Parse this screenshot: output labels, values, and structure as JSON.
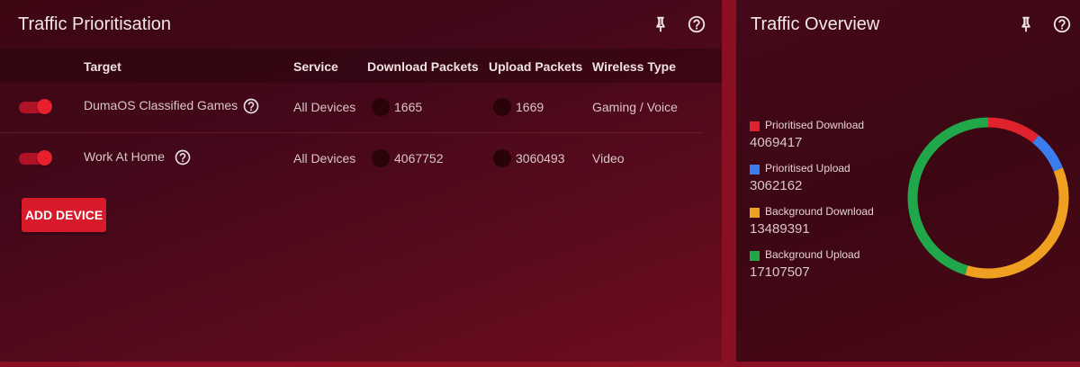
{
  "prioritisation": {
    "title": "Traffic Prioritisation",
    "columns": {
      "target": "Target",
      "service": "Service",
      "download": "Download Packets",
      "upload": "Upload Packets",
      "wireless": "Wireless Type"
    },
    "rows": [
      {
        "enabled": true,
        "target": "DumaOS Classified Games",
        "service": "All Devices",
        "download": "1665",
        "upload": "1669",
        "wireless": "Gaming / Voice"
      },
      {
        "enabled": true,
        "target": "Work At Home",
        "service": "All Devices",
        "download": "4067752",
        "upload": "3060493",
        "wireless": "Video"
      }
    ],
    "add_button": "ADD DEVICE"
  },
  "overview": {
    "title": "Traffic Overview",
    "legend": [
      {
        "label": "Prioritised Download",
        "value": "4069417",
        "color": "#e0222c"
      },
      {
        "label": "Prioritised Upload",
        "value": "3062162",
        "color": "#3b7df0"
      },
      {
        "label": "Background Download",
        "value": "13489391",
        "color": "#efa020"
      },
      {
        "label": "Background Upload",
        "value": "17107507",
        "color": "#20a74a"
      }
    ]
  },
  "chart_data": {
    "type": "pie",
    "categories": [
      "Prioritised Download",
      "Prioritised Upload",
      "Background Download",
      "Background Upload"
    ],
    "values": [
      4069417,
      3062162,
      13489391,
      17107507
    ],
    "colors": [
      "#e0222c",
      "#3b7df0",
      "#efa020",
      "#20a74a"
    ],
    "donut": true
  }
}
